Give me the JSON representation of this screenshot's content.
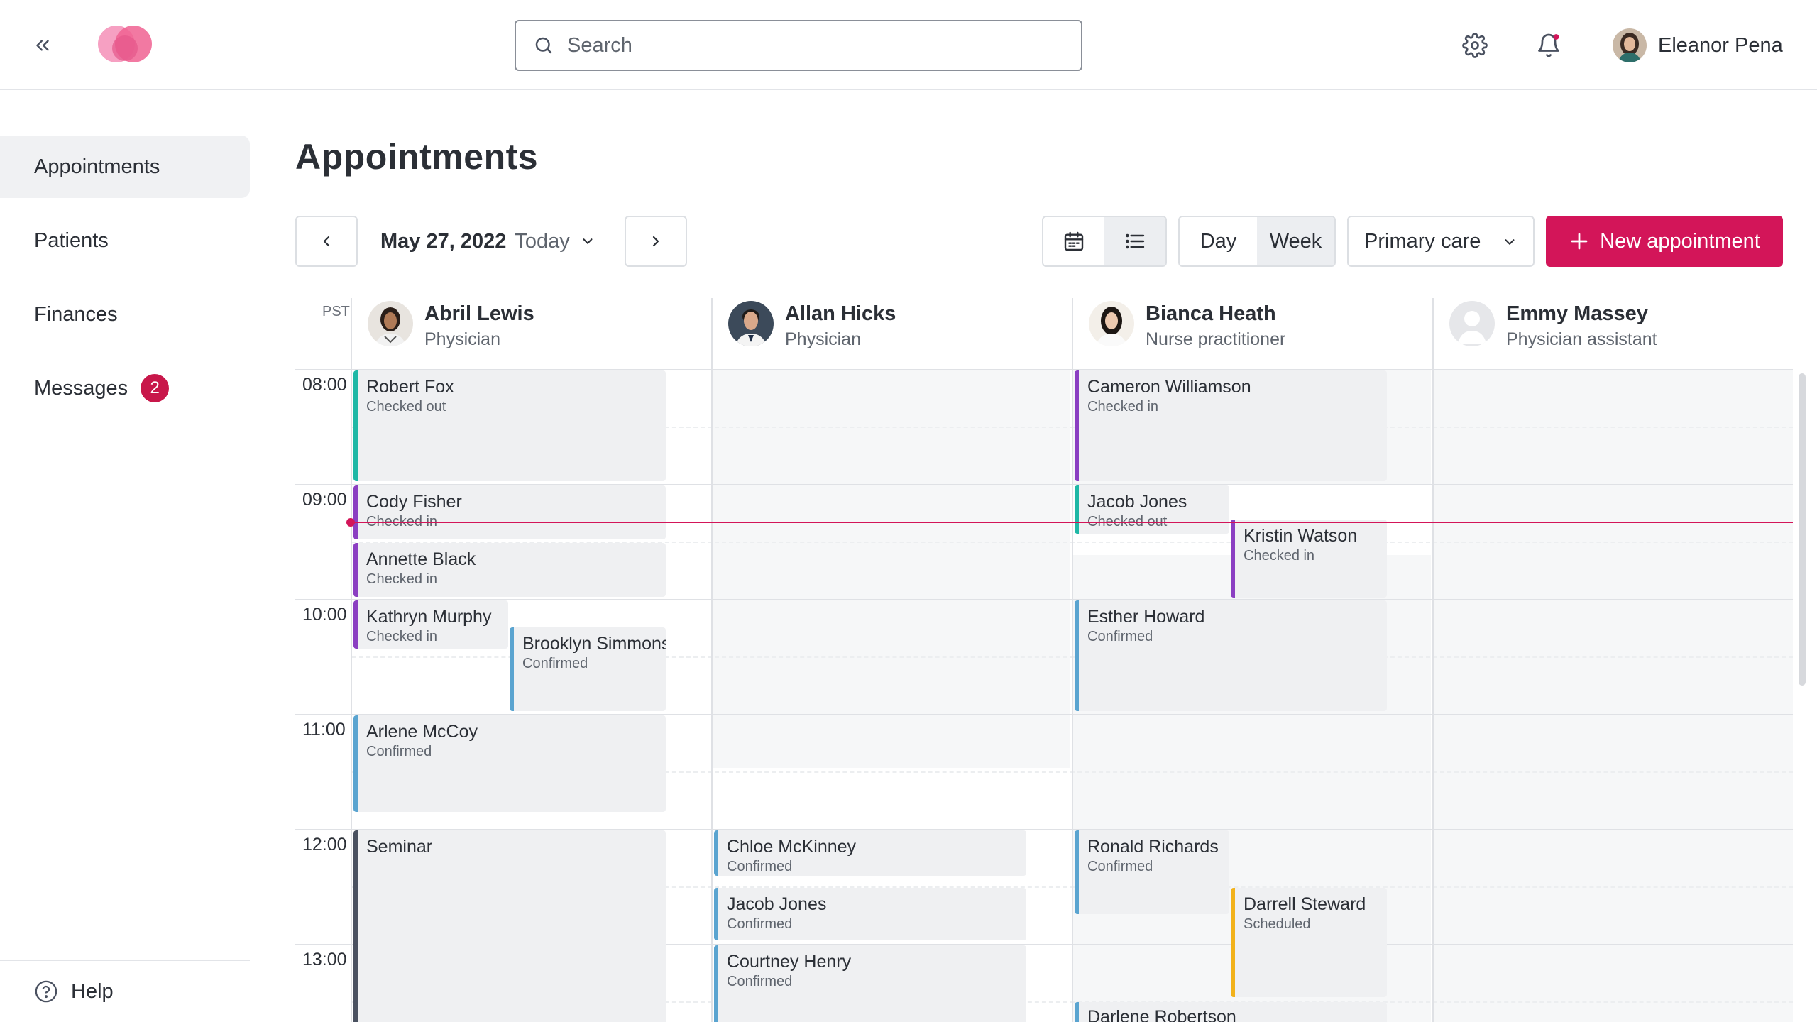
{
  "header": {
    "search_placeholder": "Search",
    "user_name": "Eleanor Pena",
    "brand_color": "#d31559",
    "notification_dot_color": "#d31559"
  },
  "sidebar": {
    "items": [
      {
        "label": "Appointments",
        "active": true
      },
      {
        "label": "Patients"
      },
      {
        "label": "Finances"
      },
      {
        "label": "Messages",
        "badge": "2"
      }
    ],
    "help_label": "Help"
  },
  "main": {
    "title": "Appointments",
    "date": "May 27, 2022",
    "today_label": "Today",
    "view_modes": [
      "calendar-icon",
      "list-icon"
    ],
    "active_view": "list",
    "range_day": "Day",
    "range_week": "Week",
    "active_range": "Week",
    "care_filter": "Primary care",
    "new_appointment_label": "New appointment"
  },
  "calendar": {
    "timezone": "PST",
    "hours": [
      "08:00",
      "09:00",
      "10:00",
      "11:00",
      "12:00",
      "13:00"
    ],
    "providers": [
      {
        "name": "Abril Lewis",
        "role": "Physician"
      },
      {
        "name": "Allan Hicks",
        "role": "Physician"
      },
      {
        "name": "Bianca Heath",
        "role": "Nurse practitioner"
      },
      {
        "name": "Emmy Massey",
        "role": "Physician assistant"
      }
    ],
    "status_colors": {
      "Checked out": "#1fb8a6",
      "Checked in": "#8b3fc2",
      "Confirmed": "#5aa4d0",
      "Scheduled": "#f2b21b",
      "Seminar": "#4a5160"
    },
    "appointments": [
      {
        "provider": 0,
        "name": "Robert Fox",
        "status": "Checked out"
      },
      {
        "provider": 0,
        "name": "Cody Fisher",
        "status": "Checked in"
      },
      {
        "provider": 0,
        "name": "Annette Black",
        "status": "Checked in"
      },
      {
        "provider": 0,
        "name": "Kathryn Murphy",
        "status": "Checked in"
      },
      {
        "provider": 0,
        "name": "Brooklyn Simmons",
        "status": "Confirmed"
      },
      {
        "provider": 0,
        "name": "Arlene McCoy",
        "status": "Confirmed"
      },
      {
        "provider": 0,
        "name": "Seminar",
        "status": ""
      },
      {
        "provider": 1,
        "name": "Chloe McKinney",
        "status": "Confirmed"
      },
      {
        "provider": 1,
        "name": "Jacob Jones",
        "status": "Confirmed"
      },
      {
        "provider": 1,
        "name": "Courtney Henry",
        "status": "Confirmed"
      },
      {
        "provider": 2,
        "name": "Cameron Williamson",
        "status": "Checked in"
      },
      {
        "provider": 2,
        "name": "Jacob Jones",
        "status": "Checked out"
      },
      {
        "provider": 2,
        "name": "Kristin Watson",
        "status": "Checked in"
      },
      {
        "provider": 2,
        "name": "Esther Howard",
        "status": "Confirmed"
      },
      {
        "provider": 2,
        "name": "Ronald Richards",
        "status": "Confirmed"
      },
      {
        "provider": 2,
        "name": "Darrell Steward",
        "status": "Scheduled"
      },
      {
        "provider": 2,
        "name": "Darlene Robertson",
        "status": ""
      }
    ]
  }
}
